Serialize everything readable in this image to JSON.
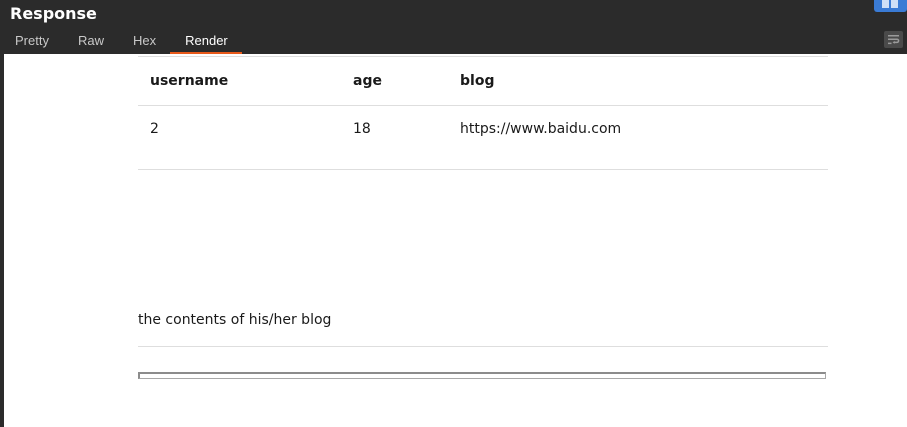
{
  "panel": {
    "title": "Response"
  },
  "tabs": [
    {
      "label": "Pretty",
      "active": false
    },
    {
      "label": "Raw",
      "active": false
    },
    {
      "label": "Hex",
      "active": false
    },
    {
      "label": "Render",
      "active": true
    }
  ],
  "render": {
    "table": {
      "headers": [
        "username",
        "age",
        "blog"
      ],
      "rows": [
        [
          "2",
          "18",
          "https://www.baidu.com"
        ]
      ]
    },
    "content_text": "the contents of his/her blog"
  },
  "colors": {
    "accent": "#e8591a",
    "layout_button": "#3a7bd5",
    "background": "#2b2b2b"
  }
}
